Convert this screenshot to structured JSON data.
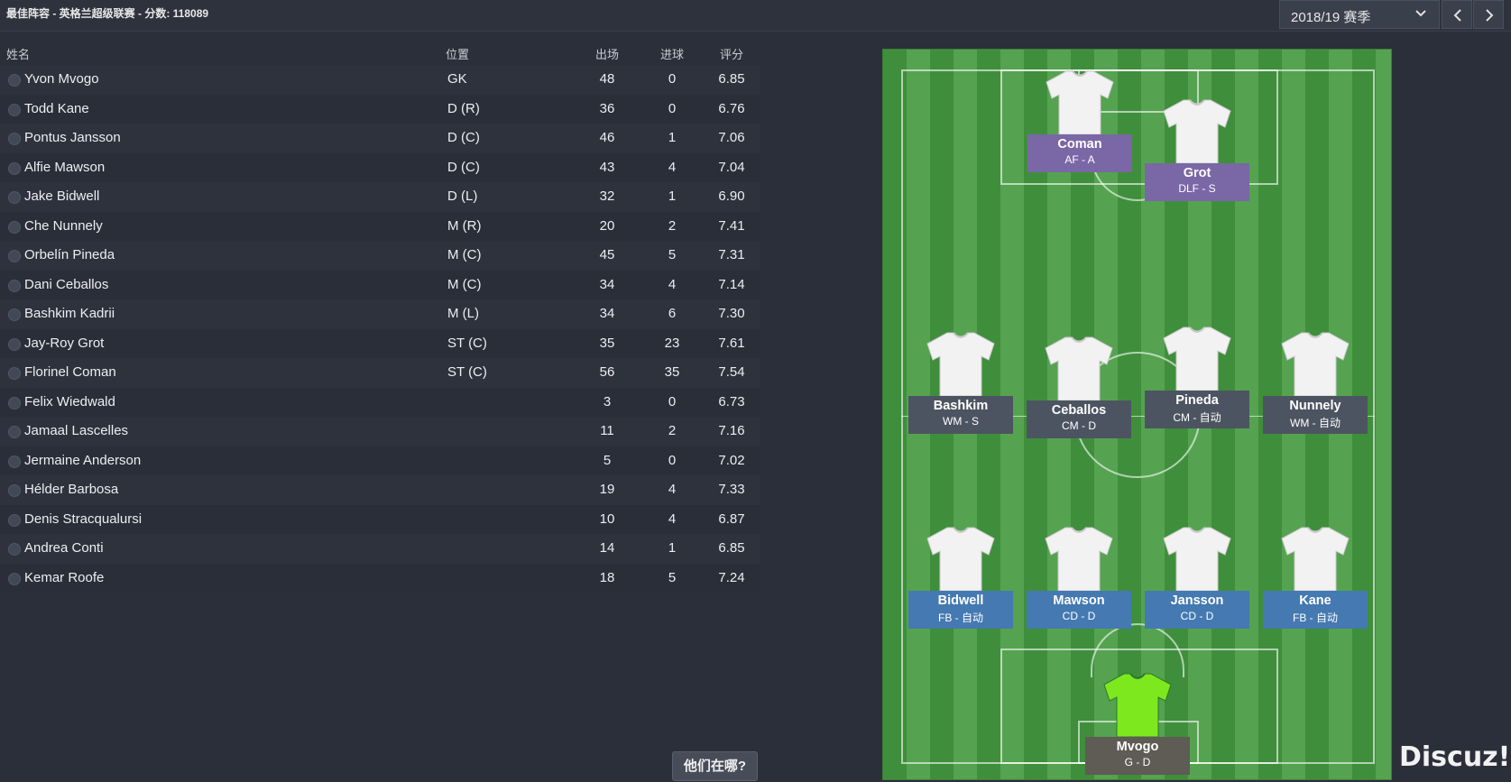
{
  "header": {
    "title": "最佳阵容 - 英格兰超级联赛 - 分数: 118089",
    "season_label": "2018/19 赛季"
  },
  "table": {
    "headers": {
      "name": "姓名",
      "position": "位置",
      "apps": "出场",
      "goals": "进球",
      "rating": "评分"
    },
    "rows": [
      {
        "name": "Yvon Mvogo",
        "position": "GK",
        "apps": "48",
        "goals": "0",
        "rating": "6.85"
      },
      {
        "name": "Todd Kane",
        "position": "D (R)",
        "apps": "36",
        "goals": "0",
        "rating": "6.76"
      },
      {
        "name": "Pontus Jansson",
        "position": "D (C)",
        "apps": "46",
        "goals": "1",
        "rating": "7.06"
      },
      {
        "name": "Alfie Mawson",
        "position": "D (C)",
        "apps": "43",
        "goals": "4",
        "rating": "7.04"
      },
      {
        "name": "Jake Bidwell",
        "position": "D (L)",
        "apps": "32",
        "goals": "1",
        "rating": "6.90"
      },
      {
        "name": "Che Nunnely",
        "position": "M (R)",
        "apps": "20",
        "goals": "2",
        "rating": "7.41"
      },
      {
        "name": "Orbelín Pineda",
        "position": "M (C)",
        "apps": "45",
        "goals": "5",
        "rating": "7.31"
      },
      {
        "name": "Dani Ceballos",
        "position": "M (C)",
        "apps": "34",
        "goals": "4",
        "rating": "7.14"
      },
      {
        "name": "Bashkim Kadrii",
        "position": "M (L)",
        "apps": "34",
        "goals": "6",
        "rating": "7.30"
      },
      {
        "name": "Jay-Roy Grot",
        "position": "ST (C)",
        "apps": "35",
        "goals": "23",
        "rating": "7.61"
      },
      {
        "name": "Florinel Coman",
        "position": "ST (C)",
        "apps": "56",
        "goals": "35",
        "rating": "7.54"
      },
      {
        "name": "Felix Wiedwald",
        "position": "",
        "apps": "3",
        "goals": "0",
        "rating": "6.73"
      },
      {
        "name": "Jamaal Lascelles",
        "position": "",
        "apps": "11",
        "goals": "2",
        "rating": "7.16"
      },
      {
        "name": "Jermaine Anderson",
        "position": "",
        "apps": "5",
        "goals": "0",
        "rating": "7.02"
      },
      {
        "name": "Hélder Barbosa",
        "position": "",
        "apps": "19",
        "goals": "4",
        "rating": "7.33"
      },
      {
        "name": "Denis Stracqualursi",
        "position": "",
        "apps": "10",
        "goals": "4",
        "rating": "6.87"
      },
      {
        "name": "Andrea Conti",
        "position": "",
        "apps": "14",
        "goals": "1",
        "rating": "6.85"
      },
      {
        "name": "Kemar Roofe",
        "position": "",
        "apps": "18",
        "goals": "5",
        "rating": "7.24"
      }
    ]
  },
  "pitch": {
    "attackers": [
      {
        "name": "Coman",
        "role": "AF  - A"
      },
      {
        "name": "Grot",
        "role": "DLF  - S"
      }
    ],
    "midfielders": [
      {
        "name": "Bashkim",
        "role": "WM  - S"
      },
      {
        "name": "Ceballos",
        "role": "CM  - D"
      },
      {
        "name": "Pineda",
        "role": "CM  - 自动"
      },
      {
        "name": "Nunnely",
        "role": "WM  - 自动"
      }
    ],
    "defenders": [
      {
        "name": "Bidwell",
        "role": "FB  - 自动"
      },
      {
        "name": "Mawson",
        "role": "CD  - D"
      },
      {
        "name": "Jansson",
        "role": "CD  - D"
      },
      {
        "name": "Kane",
        "role": "FB  - 自动"
      }
    ],
    "goalkeeper": {
      "name": "Mvogo",
      "role": "G  - D"
    }
  },
  "where_button": "他们在哪?",
  "watermark": "Discuz!",
  "colors": {
    "background": "#2b2f3a",
    "pitch_green": "#4a9a46",
    "attacker_label": "#7a67a6",
    "midfielder_label": "#4d5461",
    "defender_label": "#4479b1",
    "goalkeeper_shirt": "#7ee81e"
  },
  "icons": [
    "chevron-down-icon",
    "chevron-left-icon",
    "chevron-right-icon",
    "shirt-icon"
  ]
}
